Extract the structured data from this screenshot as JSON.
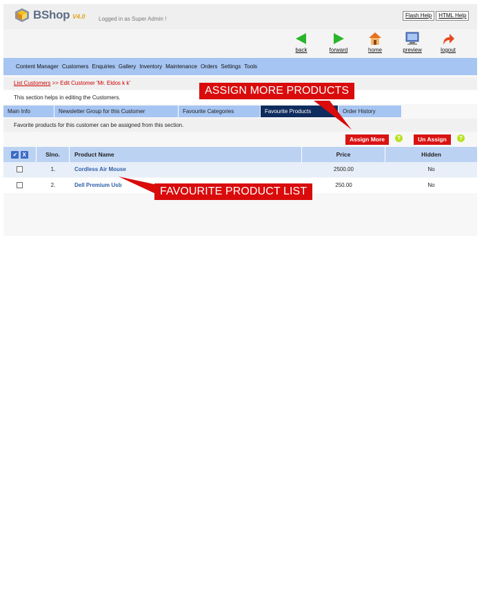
{
  "header": {
    "logo_text": "BShop",
    "version": "V4.0",
    "logged_in": "Logged in as Super Admin !",
    "help_links": [
      "Flash Help",
      "HTML Help"
    ]
  },
  "toolbar": {
    "back": "back",
    "forward": "forward",
    "home": "home",
    "preview": "preview",
    "logout": "logout"
  },
  "menu": [
    "Content Manager",
    "Customers",
    "Enquiries",
    "Gallery",
    "Inventory",
    "Maintenance",
    "Orders",
    "Settings",
    "Tools"
  ],
  "breadcrumb": {
    "link": "List Customers",
    "rest": " >> Edit Customer 'Mr. Eldos k k'"
  },
  "section_help": "This section helps in editing the Customers.",
  "tabs": [
    {
      "label": "Main Info",
      "active": false
    },
    {
      "label": "Newsletter Group for this Customer",
      "active": false
    },
    {
      "label": "Favourite Categories",
      "active": false
    },
    {
      "label": "Favourite Products",
      "active": true
    },
    {
      "label": "Order History",
      "active": false
    }
  ],
  "tab_description": "Favorite products for this customer can be assigned from this section.",
  "actions": {
    "assign_more": "Assign More",
    "un_assign": "Un Assign",
    "help_mark": "?"
  },
  "table": {
    "check_all": "✔",
    "uncheck_all": "X",
    "columns": [
      "Slno.",
      "Product Name",
      "Price",
      "Hidden"
    ],
    "rows": [
      {
        "slno": "1.",
        "name": "Cordless Air Mouse",
        "price": "2500.00",
        "hidden": "No"
      },
      {
        "slno": "2.",
        "name": "Dell Premium Usb",
        "price": "250.00",
        "hidden": "No"
      }
    ]
  },
  "callouts": {
    "assign_more_products": "ASSIGN MORE PRODUCTS",
    "favourite_product_list": "FAVOURITE PRODUCT LIST"
  },
  "colors": {
    "menubar": "#a6c5f2",
    "active_tab": "#0f2c5e",
    "action_red": "#d91313",
    "callout_red": "#d90b0b"
  }
}
